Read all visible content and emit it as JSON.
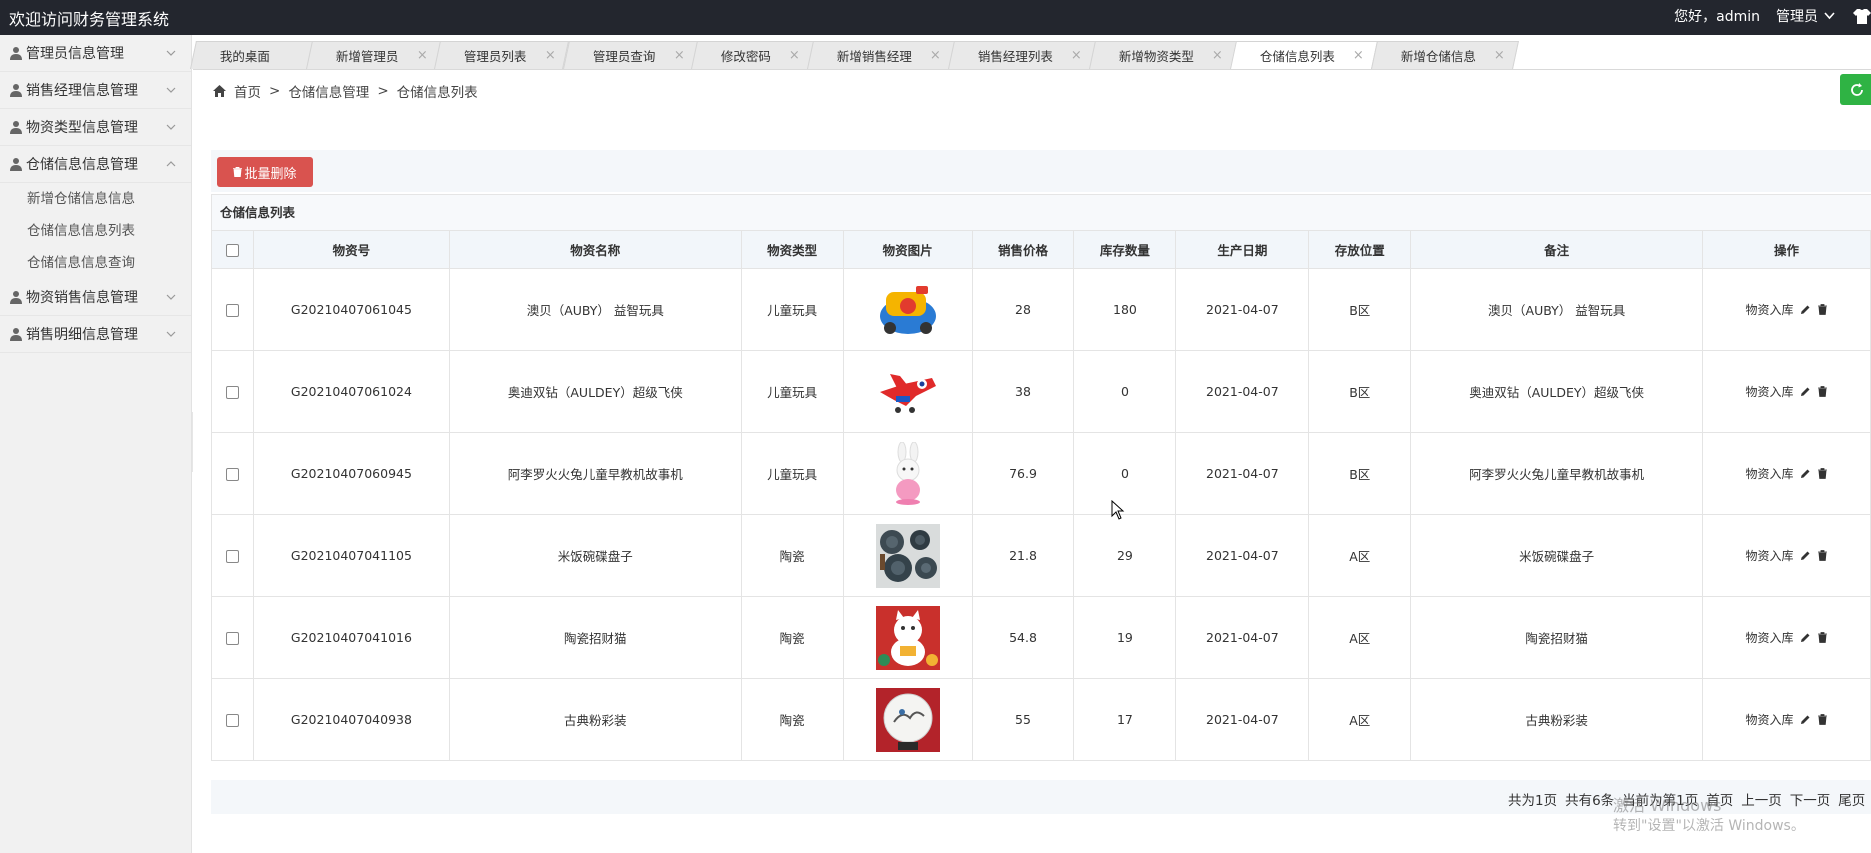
{
  "header": {
    "title": "欢迎访问财务管理系统",
    "greeting": "您好，admin",
    "role": "管理员"
  },
  "sidebar": {
    "items": [
      {
        "label": "管理员信息管理"
      },
      {
        "label": "销售经理信息管理"
      },
      {
        "label": "物资类型信息管理"
      },
      {
        "label": "仓储信息信息管理",
        "expanded": true,
        "children": [
          "新增仓储信息信息",
          "仓储信息信息列表",
          "仓储信息信息查询"
        ]
      },
      {
        "label": "物资销售信息管理"
      },
      {
        "label": "销售明细信息管理"
      }
    ]
  },
  "tabs": [
    {
      "label": "我的桌面",
      "closable": false
    },
    {
      "label": "新增管理员",
      "closable": true
    },
    {
      "label": "管理员列表",
      "closable": true
    },
    {
      "label": "管理员查询",
      "closable": true
    },
    {
      "label": "修改密码",
      "closable": true
    },
    {
      "label": "新增销售经理",
      "closable": true
    },
    {
      "label": "销售经理列表",
      "closable": true
    },
    {
      "label": "新增物资类型",
      "closable": true
    },
    {
      "label": "仓储信息列表",
      "closable": true,
      "active": true
    },
    {
      "label": "新增仓储信息",
      "closable": true
    }
  ],
  "breadcrumb": {
    "home": "首页",
    "sep": ">",
    "level1": "仓储信息管理",
    "level2": "仓储信息列表"
  },
  "toolbar": {
    "batch_delete": "批量删除"
  },
  "table": {
    "title": "仓储信息列表",
    "columns": [
      "物资号",
      "物资名称",
      "物资类型",
      "物资图片",
      "销售价格",
      "库存数量",
      "生产日期",
      "存放位置",
      "备注",
      "操作"
    ],
    "rows": [
      {
        "id": "G20210407061045",
        "name": "澳贝（AUBY） 益智玩具",
        "type": "儿童玩具",
        "image": "toy-car-icon",
        "price": "28",
        "stock": "180",
        "date": "2021-04-07",
        "location": "B区",
        "note": "澳贝（AUBY） 益智玩具"
      },
      {
        "id": "G20210407061024",
        "name": "奥迪双钻（AULDEY）超级飞侠",
        "type": "儿童玩具",
        "image": "toy-plane-icon",
        "price": "38",
        "stock": "0",
        "date": "2021-04-07",
        "location": "B区",
        "note": "奥迪双钻（AULDEY）超级飞侠"
      },
      {
        "id": "G20210407060945",
        "name": "阿李罗火火兔儿童早教机故事机",
        "type": "儿童玩具",
        "image": "toy-rabbit-icon",
        "price": "76.9",
        "stock": "0",
        "date": "2021-04-07",
        "location": "B区",
        "note": "阿李罗火火兔儿童早教机故事机"
      },
      {
        "id": "G20210407041105",
        "name": "米饭碗碟盘子",
        "type": "陶瓷",
        "image": "ceramic-dishes-icon",
        "price": "21.8",
        "stock": "29",
        "date": "2021-04-07",
        "location": "A区",
        "note": "米饭碗碟盘子"
      },
      {
        "id": "G20210407041016",
        "name": "陶瓷招财猫",
        "type": "陶瓷",
        "image": "lucky-cat-icon",
        "price": "54.8",
        "stock": "19",
        "date": "2021-04-07",
        "location": "A区",
        "note": "陶瓷招财猫"
      },
      {
        "id": "G20210407040938",
        "name": "古典粉彩装",
        "type": "陶瓷",
        "image": "decor-plate-icon",
        "price": "55",
        "stock": "17",
        "date": "2021-04-07",
        "location": "A区",
        "note": "古典粉彩装"
      }
    ],
    "row_action": "物资入库"
  },
  "pager": {
    "total_pages": "共为1页",
    "total_items": "共有6条",
    "current": "当前为第1页",
    "first": "首页",
    "prev": "上一页",
    "next": "下一页",
    "last": "尾页"
  },
  "watermark": {
    "line1": "激活 Windows",
    "line2": "转到\"设置\"以激活 Windows。"
  }
}
